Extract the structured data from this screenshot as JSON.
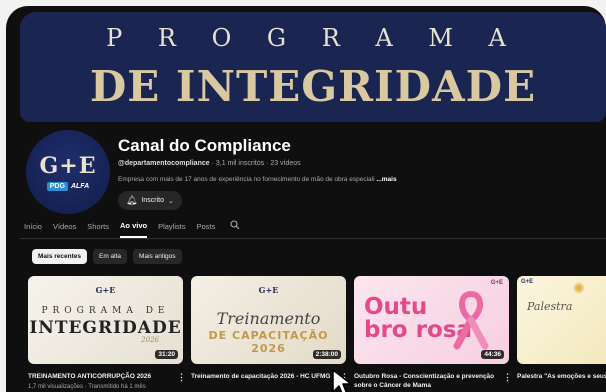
{
  "banner": {
    "line1": "P R O G R A M A",
    "line2": "DE INTEGRIDADE"
  },
  "channel": {
    "avatar": {
      "mark": "G+E",
      "pill": "PDG",
      "brand": "ALFA"
    },
    "name": "Canal do Compliance",
    "handle": "@departamentocompliance",
    "stats": "· 3,1 mil inscritos · 23 vídeos",
    "description": "Empresa com mais de 17 anos de experiência no fornecimento de mão de obra especiali",
    "more": "...mais",
    "subscribe_label": "Inscrito",
    "bell_icon": "bell-icon"
  },
  "tabs": [
    {
      "label": "Início",
      "active": false
    },
    {
      "label": "Vídeos",
      "active": false
    },
    {
      "label": "Shorts",
      "active": false
    },
    {
      "label": "Ao vivo",
      "active": true
    },
    {
      "label": "Playlists",
      "active": false
    },
    {
      "label": "Posts",
      "active": false
    }
  ],
  "chips": [
    {
      "label": "Mais recentes",
      "active": true
    },
    {
      "label": "Em alta",
      "active": false
    },
    {
      "label": "Mais antigos",
      "active": false
    }
  ],
  "videos": [
    {
      "thumb_logo": "G+E",
      "thumb_line1": "PROGRAMA DE",
      "thumb_line2": "INTEGRIDADE",
      "thumb_line3": "2026",
      "duration": "31:20",
      "title": "TREINAMENTO ANTICORRUPÇÃO 2026",
      "meta": "1,7 mil visualizações · Transmitido há 1 mês"
    },
    {
      "thumb_logo": "G+E",
      "thumb_line1": "Treinamento",
      "thumb_line2": "DE CAPACITAÇÃO 2026",
      "duration": "2:38:00",
      "title": "Treinamento de capacitação 2026 - HC UFMG",
      "meta": ""
    },
    {
      "thumb_line1": "Outu",
      "thumb_line2": "bro rosa",
      "thumb_corner": "G+E",
      "duration": "44:36",
      "title": "Outubro Rosa - Conscientização e prevenção sobre o Câncer de Mama",
      "meta": ""
    },
    {
      "thumb_corner": "G+E",
      "thumb_line1": "Palestra",
      "title": "Palestra \"As emoções e seus comportamentos e nas orga",
      "meta": ""
    }
  ],
  "colors": {
    "background": "#0f0f0f",
    "banner": "#1b2552",
    "banner_gold": "#d9c9a0",
    "pink": "#e5498a"
  }
}
